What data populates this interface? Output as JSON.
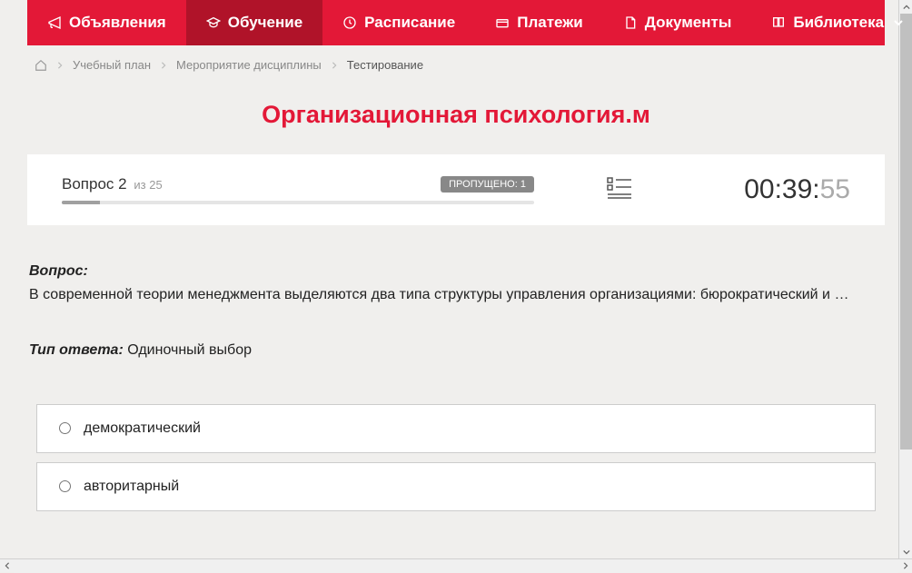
{
  "nav": {
    "items": [
      {
        "label": "Объявления",
        "icon": "megaphone",
        "active": false
      },
      {
        "label": "Обучение",
        "icon": "graduation",
        "active": true
      },
      {
        "label": "Расписание",
        "icon": "clock",
        "active": false
      },
      {
        "label": "Платежи",
        "icon": "payment",
        "active": false
      },
      {
        "label": "Документы",
        "icon": "document",
        "active": false
      },
      {
        "label": "Библиотека",
        "icon": "book",
        "active": false,
        "hasDropdown": true
      }
    ]
  },
  "breadcrumb": {
    "items": [
      {
        "label": "Учебный план",
        "current": false
      },
      {
        "label": "Мероприятие дисциплины",
        "current": false
      },
      {
        "label": "Тестирование",
        "current": true
      }
    ]
  },
  "page_title": "Организационная психология.м",
  "status": {
    "question_prefix": "Вопрос",
    "question_num": "2",
    "question_of": "из",
    "question_total": "25",
    "skipped_label": "ПРОПУЩЕНО:",
    "skipped_count": "1",
    "progress_percent": 8
  },
  "timer": {
    "main": "00:39:",
    "seconds": "55"
  },
  "question": {
    "label": "Вопрос:",
    "text": "В современной теории менеджмента выделяются два типа структуры управления организациями: бюрократический и …",
    "answer_type_label": "Тип ответа:",
    "answer_type_value": "Одиночный выбор"
  },
  "options": [
    {
      "text": "демократический"
    },
    {
      "text": "авторитарный"
    }
  ]
}
